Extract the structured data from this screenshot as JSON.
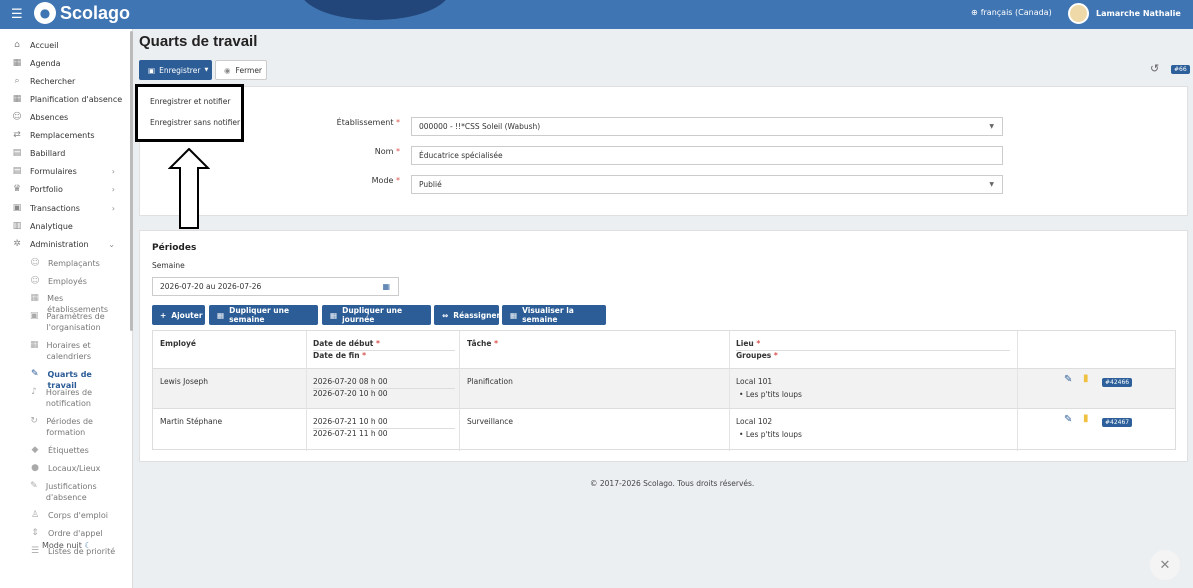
{
  "topbar": {
    "logo": "Scolago",
    "language": "français (Canada)",
    "user": "Lamarche Nathalie"
  },
  "sidebar": {
    "items": [
      {
        "label": "Accueil",
        "icon": "home-icon",
        "glyph": "⌂"
      },
      {
        "label": "Agenda",
        "icon": "calendar-icon",
        "glyph": "▦"
      },
      {
        "label": "Rechercher",
        "icon": "search-icon",
        "glyph": "⌕"
      },
      {
        "label": "Planification d'absence",
        "icon": "calendar-icon",
        "glyph": "▦"
      },
      {
        "label": "Absences",
        "icon": "user-minus-icon",
        "glyph": "☺"
      },
      {
        "label": "Remplacements",
        "icon": "swap-icon",
        "glyph": "⇄"
      },
      {
        "label": "Babillard",
        "icon": "board-icon",
        "glyph": "▤"
      },
      {
        "label": "Formulaires",
        "icon": "form-icon",
        "glyph": "▤"
      },
      {
        "label": "Portfolio",
        "icon": "trophy-icon",
        "glyph": "♛"
      },
      {
        "label": "Transactions",
        "icon": "list-icon",
        "glyph": "▣"
      },
      {
        "label": "Analytique",
        "icon": "chart-icon",
        "glyph": "▥"
      },
      {
        "label": "Administration",
        "icon": "gear-icon",
        "glyph": "✲"
      }
    ],
    "subitems": [
      {
        "label": "Remplaçants",
        "icon": "users-icon",
        "glyph": "☺"
      },
      {
        "label": "Employés",
        "icon": "users-icon",
        "glyph": "☺"
      },
      {
        "label": "Mes établissements",
        "icon": "building-icon",
        "glyph": "▦"
      },
      {
        "label": "Paramètres de l'organisation",
        "icon": "settings-icon",
        "glyph": "▣"
      },
      {
        "label": "Horaires et calendriers",
        "icon": "calendar-icon",
        "glyph": "▦"
      },
      {
        "label": "Quarts de travail",
        "icon": "shift-icon",
        "glyph": "✎"
      },
      {
        "label": "Horaires de notification",
        "icon": "bell-icon",
        "glyph": "♪"
      },
      {
        "label": "Périodes de formation",
        "icon": "refresh-icon",
        "glyph": "↻"
      },
      {
        "label": "Étiquettes",
        "icon": "tag-icon",
        "glyph": "◆"
      },
      {
        "label": "Locaux/Lieux",
        "icon": "pin-icon",
        "glyph": "●"
      },
      {
        "label": "Justifications d'absence",
        "icon": "note-icon",
        "glyph": "✎"
      },
      {
        "label": "Corps d'emploi",
        "icon": "worker-icon",
        "glyph": "♙"
      },
      {
        "label": "Ordre d'appel",
        "icon": "phone-icon",
        "glyph": "⇕"
      },
      {
        "label": "Listes de priorité",
        "icon": "list-icon",
        "glyph": "☰"
      }
    ],
    "mode_nuit": "Mode nuit"
  },
  "page": {
    "title": "Quarts de travail",
    "save_label": "Enregistrer",
    "close_label": "Fermer",
    "history_badge": "#66",
    "dropdown": [
      "Enregistrer et notifier",
      "Enregistrer sans notifier"
    ]
  },
  "form": {
    "etablissement_label": "Établissement",
    "etablissement_value": "000000 - !!*CSS Soleil (Wabush)",
    "nom_label": "Nom",
    "nom_value": "Éducatrice spécialisée",
    "mode_label": "Mode",
    "mode_value": "Publié"
  },
  "periods": {
    "title": "Périodes",
    "week_label": "Semaine",
    "week_value": "2026-07-20 au 2026-07-26",
    "buttons": [
      "Ajouter",
      "Dupliquer une semaine",
      "Dupliquer une journée",
      "Réassigner",
      "Visualiser la semaine"
    ],
    "headers": {
      "employee": "Employé",
      "start": "Date de début",
      "end": "Date de fin",
      "task": "Tâche",
      "place": "Lieu",
      "groups": "Groupes"
    },
    "rows": [
      {
        "employee": "Lewis Joseph",
        "start": "2026-07-20 08 h 00",
        "end": "2026-07-20 10 h 00",
        "task": "Planification",
        "place": "Local 101",
        "group": "Les p'tits loups",
        "badge": "#42466"
      },
      {
        "employee": "Martin Stéphane",
        "start": "2026-07-21 10 h 00",
        "end": "2026-07-21 11 h 00",
        "task": "Surveillance",
        "place": "Local 102",
        "group": "Les p'tits loups",
        "badge": "#42467"
      }
    ]
  },
  "footer": "© 2017-2026 Scolago. Tous droits réservés."
}
